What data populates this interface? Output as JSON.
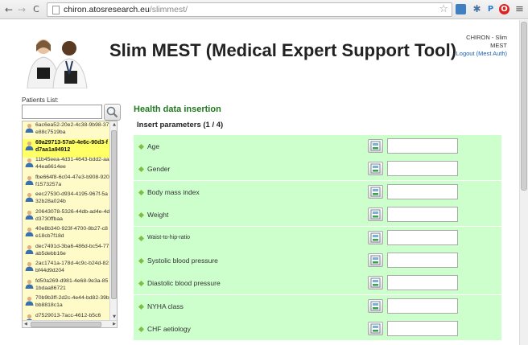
{
  "browser": {
    "url_host": "chiron.atosresearch.eu",
    "url_path": "/slimmest/",
    "back_glyph": "←",
    "forward_glyph": "→",
    "reload_glyph": "C",
    "star_glyph": "☆",
    "ext_p_glyph": "P",
    "menu_glyph": "≡",
    "icons": [
      "back-arrow-icon",
      "forward-arrow-icon",
      "reload-icon",
      "page-icon",
      "star-icon",
      "extension-icon",
      "puzzle-icon",
      "p-extension-icon",
      "opera-icon",
      "menu-icon"
    ]
  },
  "header": {
    "title": "Slim MEST (Medical Expert Support Tool)",
    "user_project": "CHIRON - Slim MEST",
    "logout": "Logout (Mest Auth)"
  },
  "patients": {
    "label": "Patients List:",
    "search_value": "",
    "items": [
      {
        "id": "6ac6ea52-20e2-4c38-9b98-37e88c7519ba",
        "selected": false
      },
      {
        "id": "69a29713-57a0-4e6c-90d3-fd7aa1a94912",
        "selected": true
      },
      {
        "id": "11b45eea-4d31-4643-bdd2-aa44ea6614ee",
        "selected": false
      },
      {
        "id": "fbe664f8-6c04-47e3-b908-920f1573257a",
        "selected": false
      },
      {
        "id": "eec27530-d934-4195-967f-5a32b28a024b",
        "selected": false
      },
      {
        "id": "20643078-5326-44db-ad4e-4dd3730ffbaa",
        "selected": false
      },
      {
        "id": "40e8b340-923f-4700-8b27-c8e18cb7f18d",
        "selected": false
      },
      {
        "id": "dec7491d-3ba6-486d-bc54-77ab5debb16e",
        "selected": false
      },
      {
        "id": "2ac1741a-178d-4c9c-b24d-82bf44d9d204",
        "selected": false
      },
      {
        "id": "fd50a269-d981-4e68-9e3a-851bdaa86721",
        "selected": false
      },
      {
        "id": "70b9b3ff-2d2c-4e44-bd82-39bbb8818c1a",
        "selected": false
      },
      {
        "id": "d7529013-7acc-4612-b5c6",
        "selected": false
      }
    ]
  },
  "main": {
    "section_title": "Health data insertion",
    "params_heading": "Insert parameters (1 / 4)",
    "params": [
      {
        "label": "Age",
        "value": ""
      },
      {
        "label": "Gender",
        "value": ""
      },
      {
        "label": "Body mass index",
        "value": ""
      },
      {
        "label": "Weight",
        "value": ""
      },
      {
        "label": "Waist-to-hip-ratio",
        "value": ""
      },
      {
        "label": "Systolic blood pressure",
        "value": ""
      },
      {
        "label": "Diastolic blood pressure",
        "value": ""
      },
      {
        "label": "NYHA class",
        "value": ""
      },
      {
        "label": "CHF aetiology",
        "value": ""
      }
    ]
  },
  "colors": {
    "row_bg": "#ccffcc",
    "list_bg": "#fffbc8",
    "selected_bg": "#ffff66",
    "section_title": "#1f7a1f",
    "link": "#1a5fb4"
  }
}
